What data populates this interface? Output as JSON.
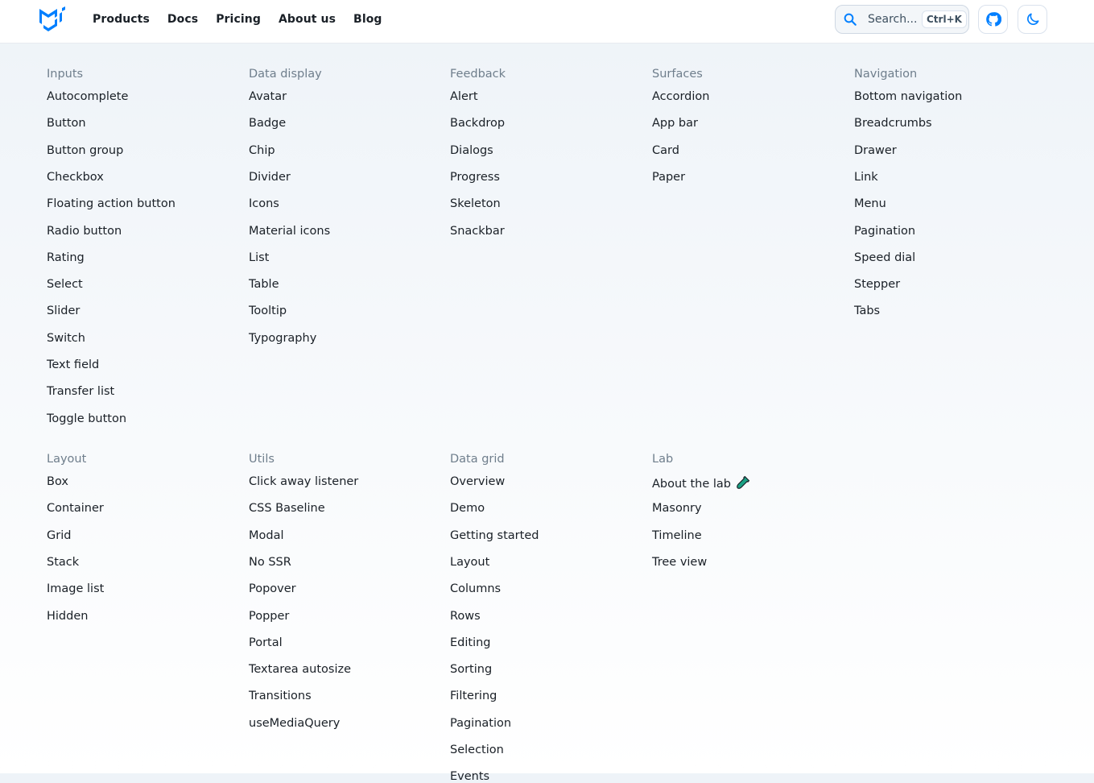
{
  "header": {
    "logo_icon": "mui-logo-icon",
    "nav": [
      "Products",
      "Docs",
      "Pricing",
      "About us",
      "Blog"
    ],
    "search": {
      "placeholder": "Search...",
      "shortcut": "Ctrl+K",
      "icon": "search-icon"
    },
    "github_icon": "github-icon",
    "mode_icon": "dark-mode-moon-icon"
  },
  "colors": {
    "primary": "#007fff",
    "text": "#1a2027",
    "category": "#6f7e8c",
    "lab_icon": "#1aa184"
  },
  "groups": [
    {
      "title": "Inputs",
      "items": [
        "Autocomplete",
        "Button",
        "Button group",
        "Checkbox",
        "Floating action button",
        "Radio button",
        "Rating",
        "Select",
        "Slider",
        "Switch",
        "Text field",
        "Transfer list",
        "Toggle button"
      ]
    },
    {
      "title": "Data display",
      "items": [
        "Avatar",
        "Badge",
        "Chip",
        "Divider",
        "Icons",
        "Material icons",
        "List",
        "Table",
        "Tooltip",
        "Typography"
      ]
    },
    {
      "title": "Feedback",
      "items": [
        "Alert",
        "Backdrop",
        "Dialogs",
        "Progress",
        "Skeleton",
        "Snackbar"
      ]
    },
    {
      "title": "Surfaces",
      "items": [
        "Accordion",
        "App bar",
        "Card",
        "Paper"
      ]
    },
    {
      "title": "Navigation",
      "items": [
        "Bottom navigation",
        "Breadcrumbs",
        "Drawer",
        "Link",
        "Menu",
        "Pagination",
        "Speed dial",
        "Stepper",
        "Tabs"
      ]
    },
    {
      "title": "Layout",
      "items": [
        "Box",
        "Container",
        "Grid",
        "Stack",
        "Image list",
        "Hidden"
      ]
    },
    {
      "title": "Utils",
      "items": [
        "Click away listener",
        "CSS Baseline",
        "Modal",
        "No SSR",
        "Popover",
        "Popper",
        "Portal",
        "Textarea autosize",
        "Transitions",
        "useMediaQuery"
      ]
    },
    {
      "title": "Data grid",
      "items": [
        "Overview",
        "Demo",
        "Getting started",
        "Layout",
        "Columns",
        "Rows",
        "Editing",
        "Sorting",
        "Filtering",
        "Pagination",
        "Selection",
        "Events"
      ]
    },
    {
      "title": "Lab",
      "items": [
        "About the lab",
        "Masonry",
        "Timeline",
        "Tree view"
      ],
      "first_item_icon": "lab-flask-icon"
    }
  ]
}
